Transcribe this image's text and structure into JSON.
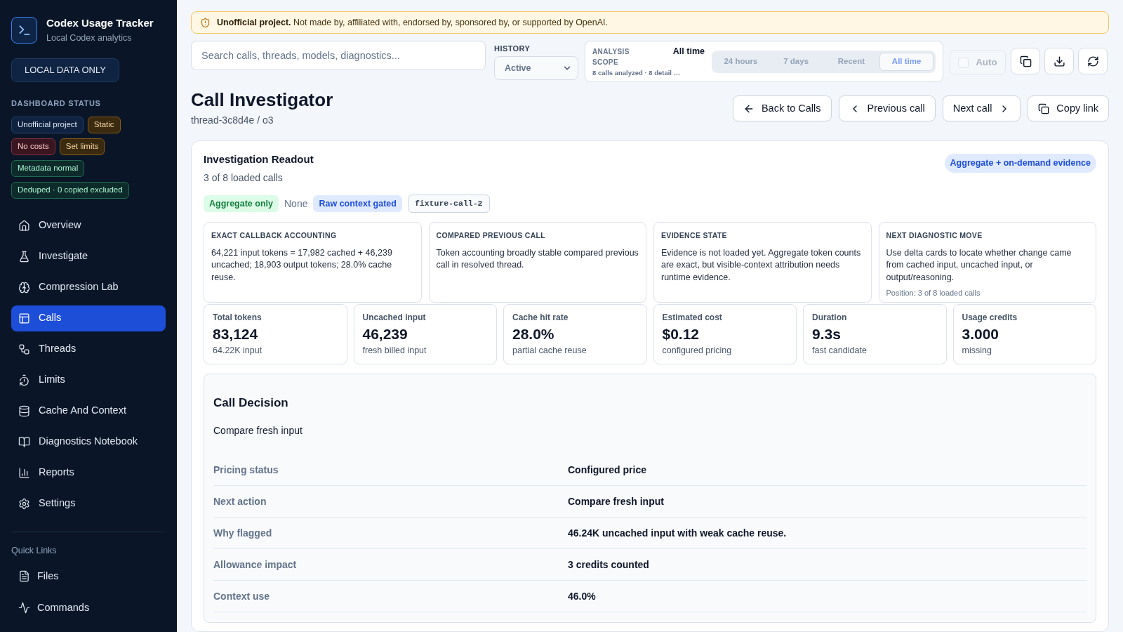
{
  "sidebar": {
    "brand": {
      "title": "Codex Usage Tracker",
      "subtitle": "Local Codex analytics"
    },
    "local_button": "LOCAL DATA ONLY",
    "status_heading": "DASHBOARD STATUS",
    "status_badges": [
      {
        "label": "Unofficial project",
        "kind": "neutral"
      },
      {
        "label": "Static",
        "kind": "warning"
      },
      {
        "label": "No costs",
        "kind": "danger"
      },
      {
        "label": "Set limits",
        "kind": "warning"
      },
      {
        "label": "Metadata normal",
        "kind": "success"
      },
      {
        "label": "Deduped · 0 copied excluded",
        "kind": "success"
      }
    ],
    "nav": [
      {
        "label": "Overview",
        "selected": false
      },
      {
        "label": "Investigate",
        "selected": false
      },
      {
        "label": "Compression Lab",
        "selected": false
      },
      {
        "label": "Calls",
        "selected": true
      },
      {
        "label": "Threads",
        "selected": false
      },
      {
        "label": "Limits",
        "selected": false
      },
      {
        "label": "Cache And Context",
        "selected": false
      },
      {
        "label": "Diagnostics Notebook",
        "selected": false
      },
      {
        "label": "Reports",
        "selected": false
      },
      {
        "label": "Settings",
        "selected": false
      }
    ],
    "quick_links_heading": "Quick Links",
    "quick_links": [
      {
        "label": "Files"
      },
      {
        "label": "Commands"
      }
    ]
  },
  "notice": "**Unofficial project.** Not made by, affiliated with, endorsed by, sponsored by, or supported by OpenAI.",
  "toolbar": {
    "search": {
      "placeholder": "Search calls, threads, models, diagnostics..."
    },
    "history": {
      "label": "HISTORY",
      "value": "Active"
    },
    "analysis_scope": {
      "label": "ANALYSIS SCOPE",
      "value": "All time",
      "detail": "8 calls analyzed · 8 detail …",
      "ranges": [
        {
          "label": "24 hours",
          "selected": false
        },
        {
          "label": "7 days",
          "selected": false
        },
        {
          "label": "Recent",
          "selected": false
        },
        {
          "label": "All time",
          "selected": true
        }
      ]
    },
    "auto": {
      "label": "Auto",
      "checked": false,
      "disabled": true
    }
  },
  "page": {
    "title": "Call Investigator",
    "subtitle": "thread-3c8d4e / o3",
    "actions": [
      {
        "label": "Back to Calls",
        "kind": "back"
      },
      {
        "label": "Previous call",
        "kind": "previous"
      },
      {
        "label": "Next call",
        "kind": "next"
      },
      {
        "label": "Copy link",
        "kind": "copy"
      }
    ]
  },
  "readout": {
    "title": "Investigation Readout",
    "subtitle": "3 of 8 loaded calls",
    "mode_badge": "Aggregate + on-demand evidence",
    "tags": [
      {
        "label": "Aggregate only",
        "kind": "success"
      },
      {
        "label": "None",
        "kind": "plain"
      },
      {
        "label": "Raw context gated",
        "kind": "info"
      },
      {
        "label": "fixture-call-2",
        "kind": "code"
      }
    ],
    "cards": [
      {
        "title": "EXACT CALLBACK ACCOUNTING",
        "body": "64,221 input tokens = 17,982 cached + 46,239 uncached; 18,903 output tokens; 28.0% cache reuse."
      },
      {
        "title": "COMPARED PREVIOUS CALL",
        "body": "Token accounting broadly stable compared previous call in resolved thread."
      },
      {
        "title": "EVIDENCE STATE",
        "body": "Evidence is not loaded yet. Aggregate token counts are exact, but visible-context attribution needs runtime evidence."
      },
      {
        "title": "NEXT DIAGNOSTIC MOVE",
        "body": "Use delta cards to locate whether change came from cached input, uncached input, or output/reasoning.",
        "note": "Position: 3 of 8 loaded calls"
      }
    ],
    "metrics": [
      {
        "label": "Total tokens",
        "value": "83,124",
        "caption": "64.22K input"
      },
      {
        "label": "Uncached input",
        "value": "46,239",
        "caption": "fresh billed input"
      },
      {
        "label": "Cache hit rate",
        "value": "28.0%",
        "caption": "partial cache reuse"
      },
      {
        "label": "Estimated cost",
        "value": "$0.12",
        "caption": "configured pricing"
      },
      {
        "label": "Duration",
        "value": "9.3s",
        "caption": "fast candidate"
      },
      {
        "label": "Usage credits",
        "value": "3.000",
        "caption": "missing"
      }
    ],
    "decision": {
      "title": "Call Decision",
      "summary": "Compare fresh input",
      "rows": [
        {
          "label": "Pricing status",
          "value": "Configured price"
        },
        {
          "label": "Next action",
          "value": "Compare fresh input"
        },
        {
          "label": "Why flagged",
          "value": "46.24K uncached input with weak cache reuse."
        },
        {
          "label": "Allowance impact",
          "value": "3 credits counted"
        },
        {
          "label": "Context use",
          "value": "46.0%"
        }
      ]
    }
  }
}
